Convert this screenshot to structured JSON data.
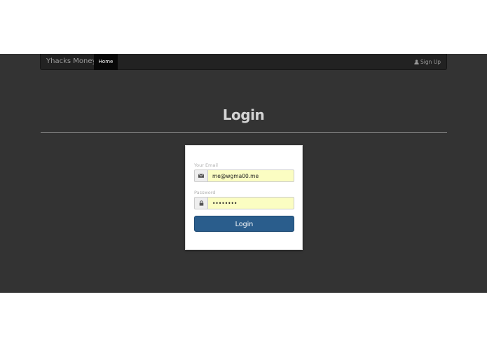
{
  "navbar": {
    "brand": "Yhacks Money",
    "home_label": "Home",
    "signup_label": "Sign Up"
  },
  "page": {
    "title": "Login"
  },
  "form": {
    "email_label": "Your Email",
    "email_value": "me@wgma00.me",
    "password_label": "Password",
    "password_value": "password",
    "submit_label": "Login"
  },
  "icons": {
    "signup": "user-icon",
    "email": "envelope-icon",
    "password": "lock-icon"
  },
  "colors": {
    "background": "#333333",
    "navbar": "#222222",
    "active_nav": "#080808",
    "primary_button": "#2a5d8c",
    "autofill": "#fbfdc2"
  }
}
